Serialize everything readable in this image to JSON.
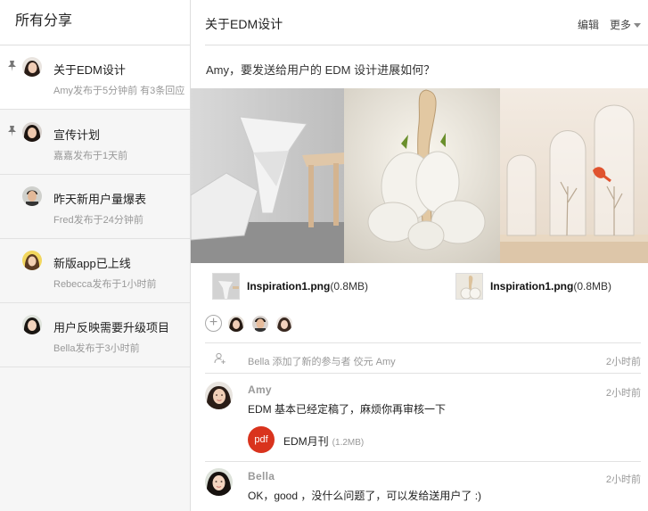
{
  "sidebar": {
    "title": "所有分享",
    "threads": [
      {
        "title": "关于EDM设计",
        "meta": "Amy发布于5分钟前 有3条回应"
      },
      {
        "title": "宣传计划",
        "meta": "嘉嘉发布于1天前"
      },
      {
        "title": "昨天新用户量爆表",
        "meta": "Fred发布于24分钟前"
      },
      {
        "title": "新版app已上线",
        "meta": "Rebecca发布于1小时前"
      },
      {
        "title": "用户反映需要升级项目",
        "meta": "Bella发布于3小时前"
      }
    ]
  },
  "topic": {
    "title": "关于EDM设计",
    "edit_label": "编辑",
    "more_label": "更多",
    "question": "Amy，要发送给用户的 EDM 设计进展如何？"
  },
  "files": [
    {
      "name": "Inspiration1.png",
      "size": "(0.8MB)"
    },
    {
      "name": "Inspiration1.png",
      "size": "(0.8MB)"
    }
  ],
  "participants": {
    "add_label": "+"
  },
  "activity": {
    "text": "Bella 添加了新的参与者 佼元 Amy",
    "time": "2小时前"
  },
  "comments": [
    {
      "author": "Amy",
      "time": "2小时前",
      "text": "EDM 基本已经定稿了，麻烦你再审核一下",
      "attachment": {
        "badge": "pdf",
        "name": "EDM月刊",
        "size": "(1.2MB)"
      }
    },
    {
      "author": "Bella",
      "time": "2小时前",
      "text": "OK，good ，没什么问题了，可以发给送用户了 :)"
    }
  ],
  "colors": {
    "pdf_badge": "#d9331d",
    "meta_gray": "#999999",
    "sidebar_bg": "#f6f6f6"
  }
}
